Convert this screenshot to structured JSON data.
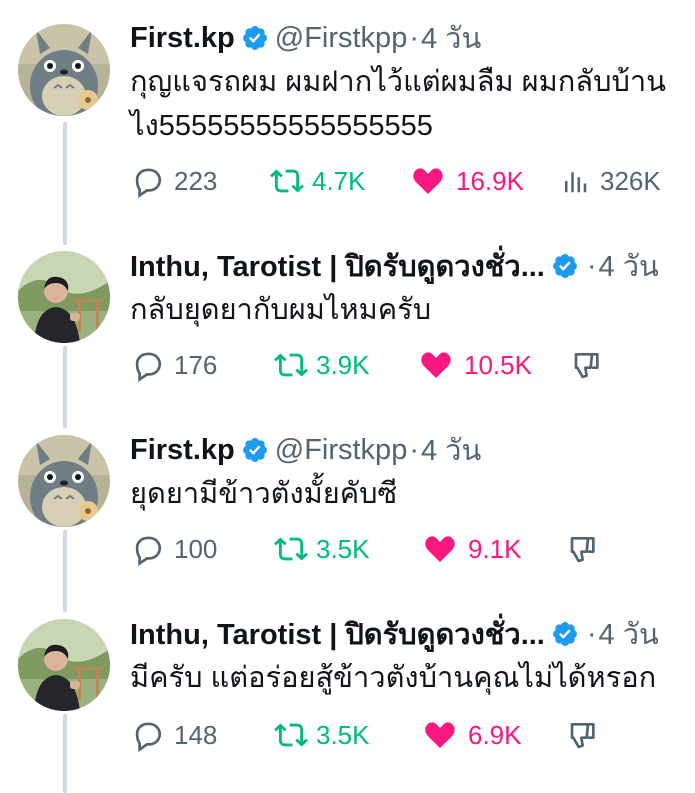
{
  "colors": {
    "text": "#0f1419",
    "secondary": "#536471",
    "retweet": "#00ba7c",
    "like": "#f91880",
    "verified": "#1d9bf0",
    "thread_line": "#cfd9de"
  },
  "tweets": [
    {
      "name": "First.kp",
      "handle": "@Firstkpp",
      "separator": "·",
      "time": "4 วัน",
      "text_lines": [
        "กุญแจรถผม ผมฝากไว้แต่ผมลืม ผมกลับบ้าน",
        "ไง55555555555555555"
      ],
      "replies": "223",
      "retweets": "4.7K",
      "likes": "16.9K",
      "views": "326K",
      "avatar": "totoro-avatar"
    },
    {
      "name": "Inthu, Tarotist | ปิดรับดูดวงชั่ว...",
      "separator": "·",
      "time": "4 วัน",
      "text_lines": [
        "กลับยุดยากับผมไหมครับ"
      ],
      "replies": "176",
      "retweets": "3.9K",
      "likes": "10.5K",
      "avatar": "person-avatar"
    },
    {
      "name": "First.kp",
      "handle": "@Firstkpp",
      "separator": "·",
      "time": "4 วัน",
      "text_lines": [
        "ยุดยามีข้าวตังมั้ยคับซี"
      ],
      "replies": "100",
      "retweets": "3.5K",
      "likes": "9.1K",
      "avatar": "totoro-avatar"
    },
    {
      "name": "Inthu, Tarotist | ปิดรับดูดวงชั่ว...",
      "separator": "·",
      "time": "4 วัน",
      "text_lines": [
        "มีครับ แต่อร่อยสู้ข้าวตังบ้านคุณไม่ได้หรอก"
      ],
      "replies": "148",
      "retweets": "3.5K",
      "likes": "6.9K",
      "avatar": "person-avatar"
    }
  ]
}
